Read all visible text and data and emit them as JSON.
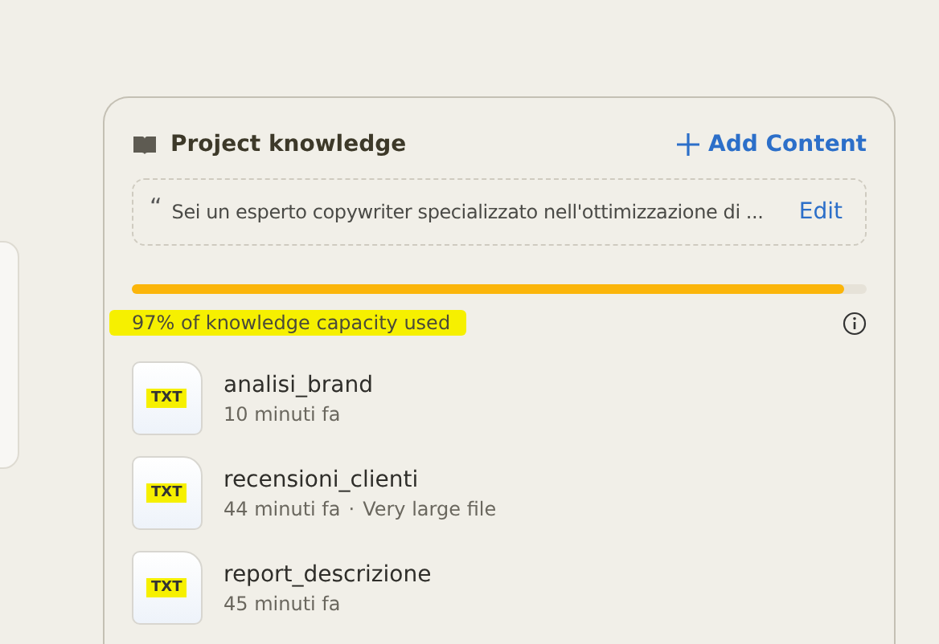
{
  "panel": {
    "title": "Project knowledge",
    "add_button": "Add Content",
    "instructions": {
      "quote": "“",
      "text": "Sei un esperto copywriter specializzato nell'ottimizzazione di ...",
      "edit": "Edit"
    },
    "capacity": {
      "level": 0.97,
      "label": "97% of knowledge capacity used",
      "highlighted": true
    },
    "files": [
      {
        "name": "analisi_brand",
        "type": "TXT",
        "time": "10 minuti fa",
        "highlighted": true
      },
      {
        "name": "recensioni_clienti",
        "type": "TXT",
        "time": "44 minuti fa",
        "separator": "·",
        "note": "Very large file",
        "highlighted": true
      },
      {
        "name": "report_descrizione",
        "type": "TXT",
        "time": "45 minuti fa",
        "highlighted": true
      }
    ]
  }
}
